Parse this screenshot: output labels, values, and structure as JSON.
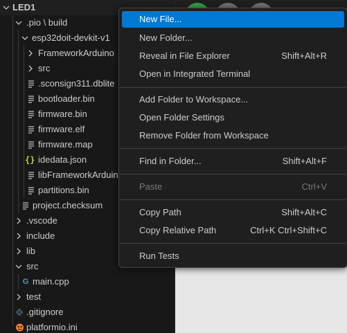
{
  "explorer": {
    "root_label": "LED1",
    "items": [
      {
        "label": ".pio \\ build"
      },
      {
        "label": "esp32doit-devkit-v1"
      },
      {
        "label": "FrameworkArduino"
      },
      {
        "label": "src"
      },
      {
        "label": ".sconsign311.dblite"
      },
      {
        "label": "bootloader.bin"
      },
      {
        "label": "firmware.bin"
      },
      {
        "label": "firmware.elf"
      },
      {
        "label": "firmware.map"
      },
      {
        "label": "idedata.json"
      },
      {
        "label": "libFrameworkArduino"
      },
      {
        "label": "partitions.bin"
      },
      {
        "label": "project.checksum"
      },
      {
        "label": ".vscode"
      },
      {
        "label": "include"
      },
      {
        "label": "lib"
      },
      {
        "label": "src"
      },
      {
        "label": "main.cpp"
      },
      {
        "label": "test"
      },
      {
        "label": ".gitignore"
      },
      {
        "label": "platformio.ini"
      }
    ]
  },
  "context_menu": {
    "items": [
      {
        "label": "New File...",
        "shortcut": ""
      },
      {
        "label": "New Folder...",
        "shortcut": ""
      },
      {
        "label": "Reveal in File Explorer",
        "shortcut": "Shift+Alt+R"
      },
      {
        "label": "Open in Integrated Terminal",
        "shortcut": ""
      },
      {
        "label": "Add Folder to Workspace...",
        "shortcut": ""
      },
      {
        "label": "Open Folder Settings",
        "shortcut": ""
      },
      {
        "label": "Remove Folder from Workspace",
        "shortcut": ""
      },
      {
        "label": "Find in Folder...",
        "shortcut": "Shift+Alt+F"
      },
      {
        "label": "Paste",
        "shortcut": "Ctrl+V"
      },
      {
        "label": "Copy Path",
        "shortcut": "Shift+Alt+C"
      },
      {
        "label": "Copy Relative Path",
        "shortcut": "Ctrl+K Ctrl+Shift+C"
      },
      {
        "label": "Run Tests",
        "shortcut": ""
      }
    ]
  },
  "colors": {
    "accent": "#0078d4",
    "json_icon": "#cbcb41",
    "cpp_icon": "#519aba",
    "platformio_icon": "#f5822a",
    "gitignore_icon": "#41535b"
  }
}
